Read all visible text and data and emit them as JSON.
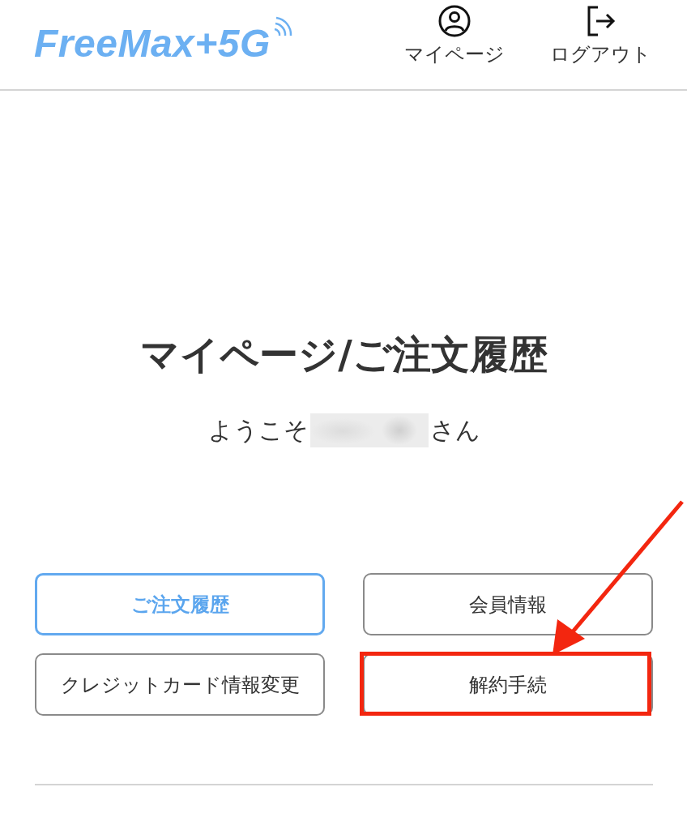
{
  "header": {
    "logo": "FreeMax+5G",
    "nav": [
      {
        "kind": "mypage",
        "label": "マイページ"
      },
      {
        "kind": "logout",
        "label": "ログアウト"
      }
    ]
  },
  "page": {
    "title": "マイページ/ご注文履歴",
    "greeting": {
      "prefix": "ようこそ",
      "suffix": "さん"
    }
  },
  "buttons": [
    {
      "label": "ご注文履歴",
      "selected": true,
      "highlighted": false
    },
    {
      "label": "会員情報",
      "selected": false,
      "highlighted": false
    },
    {
      "label": "クレジットカード情報変更",
      "selected": false,
      "highlighted": false
    },
    {
      "label": "解約手続",
      "selected": false,
      "highlighted": true
    }
  ]
}
